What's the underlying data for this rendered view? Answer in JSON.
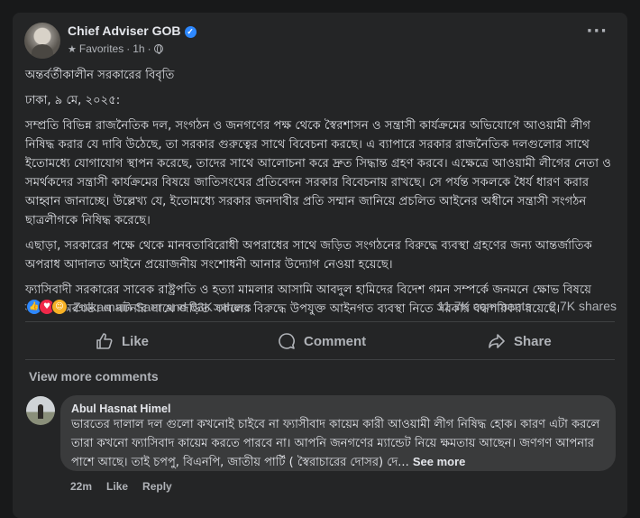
{
  "post": {
    "page_name": "Chief Adviser GOB",
    "audience": "Favorites",
    "separator": "·",
    "time": "1h",
    "dot_separator": "·",
    "more_label": "···",
    "heading": "অন্তর্বর্তীকালীন সরকারের বিবৃতি",
    "dateline": "ঢাকা, ৯ মে, ২০২৫:",
    "paragraphs": [
      "সম্প্রতি বিভিন্ন রাজনৈতিক দল, সংগঠন ও জনগণের পক্ষ থেকে স্বৈরশাসন ও সন্ত্রাসী কার্যক্রমের অভিযোগে আওয়ামী লীগ নিষিদ্ধ করার যে দাবি উঠেছে, তা সরকার গুরুত্বের সাথে বিবেচনা করছে। এ ব্যাপারে সরকার রাজনৈতিক দলগুলোর সাথে ইতোমধ্যে যোগাযোগ স্থাপন করেছে, তাদের সাথে আলোচনা করে দ্রুত সিদ্ধান্ত গ্রহণ করবে। এক্ষেত্রে আওয়ামী লীগের নেতা ও সমর্থকদের সন্ত্রাসী কার্যক্রমের বিষয়ে জাতিসংঘের প্রতিবেদন সরকার বিবেচনায় রাখছে। সে পর্যন্ত সকলকে ধৈর্য ধারণ করার আহ্বান জানাচ্ছে। উল্লেখ্য যে, ইতোমধ্যে সরকার জনদাবীর প্রতি সম্মান জানিয়ে প্রচলিত আইনের অধীনে সন্ত্রাসী সংগঠন ছাত্রলীগকে নিষিদ্ধ করেছে।",
      "এছাড়া, সরকারের পক্ষে থেকে মানবতাবিরোধী অপরাধের সাথে জড়িত সংগঠনের বিরুদ্ধে ব্যবস্থা গ্রহণের জন্য আন্তর্জাতিক অপরাধ আদালত আইনে প্রয়োজনীয় সংশোধনী আনার উদ্যোগ নেওয়া হয়েছে।",
      "ফ্যাসিবাদী সরকারের সাবেক রাষ্ট্রপতি ও হত্যা মামলার আসামি আবদুল হামিদের বিদেশ গমন সম্পর্কে জনমনে ক্ষোভ বিষয়ে সরকার অবগত। এ ঘটনার সাথে জড়িত সকলের বিরুদ্ধে উপযুক্ত আইনগত ব্যবস্থা নিতে সরকার বদ্ধপরিকর রয়েছে।"
    ]
  },
  "engagement": {
    "reactor_names": "Zulkarnain Saer and 63K others",
    "comments_count": "11.7K comments",
    "shares_count": "2.7K shares",
    "reaction_icons": [
      "like-reaction-icon",
      "love-reaction-icon",
      "haha-reaction-icon"
    ]
  },
  "actions": {
    "like": "Like",
    "comment": "Comment",
    "share": "Share"
  },
  "comments": {
    "view_more": "View more comments",
    "items": [
      {
        "author": "Abul Hasnat Himel",
        "text": "ভারতের দালাল দল গুলো কখনোই চাইবে না ফ্যাসীবাদ কায়েম কারী আওয়ামী লীগ নিষিদ্ধ হোক। কারণ এটা করলে তারা কখনো ফ্যাসিবাদ কায়েম করতে পারবে না। আপনি জনগণের ম্যান্ডেট নিয়ে ক্ষমতায় আছেন। জণগণ আপনার পাশে আছে। তাই চপপু, বিএনপি, জাতীয় পার্টি ( স্বৈরাচারের দোসর) দে...",
        "see_more": "See more",
        "time": "22m",
        "like": "Like",
        "reply": "Reply"
      }
    ]
  },
  "colors": {
    "background": "#18191a",
    "card": "#242526",
    "bubble": "#3a3b3c",
    "verified": "#2d88ff",
    "text": "#e4e6eb",
    "muted": "#b0b3b8"
  }
}
